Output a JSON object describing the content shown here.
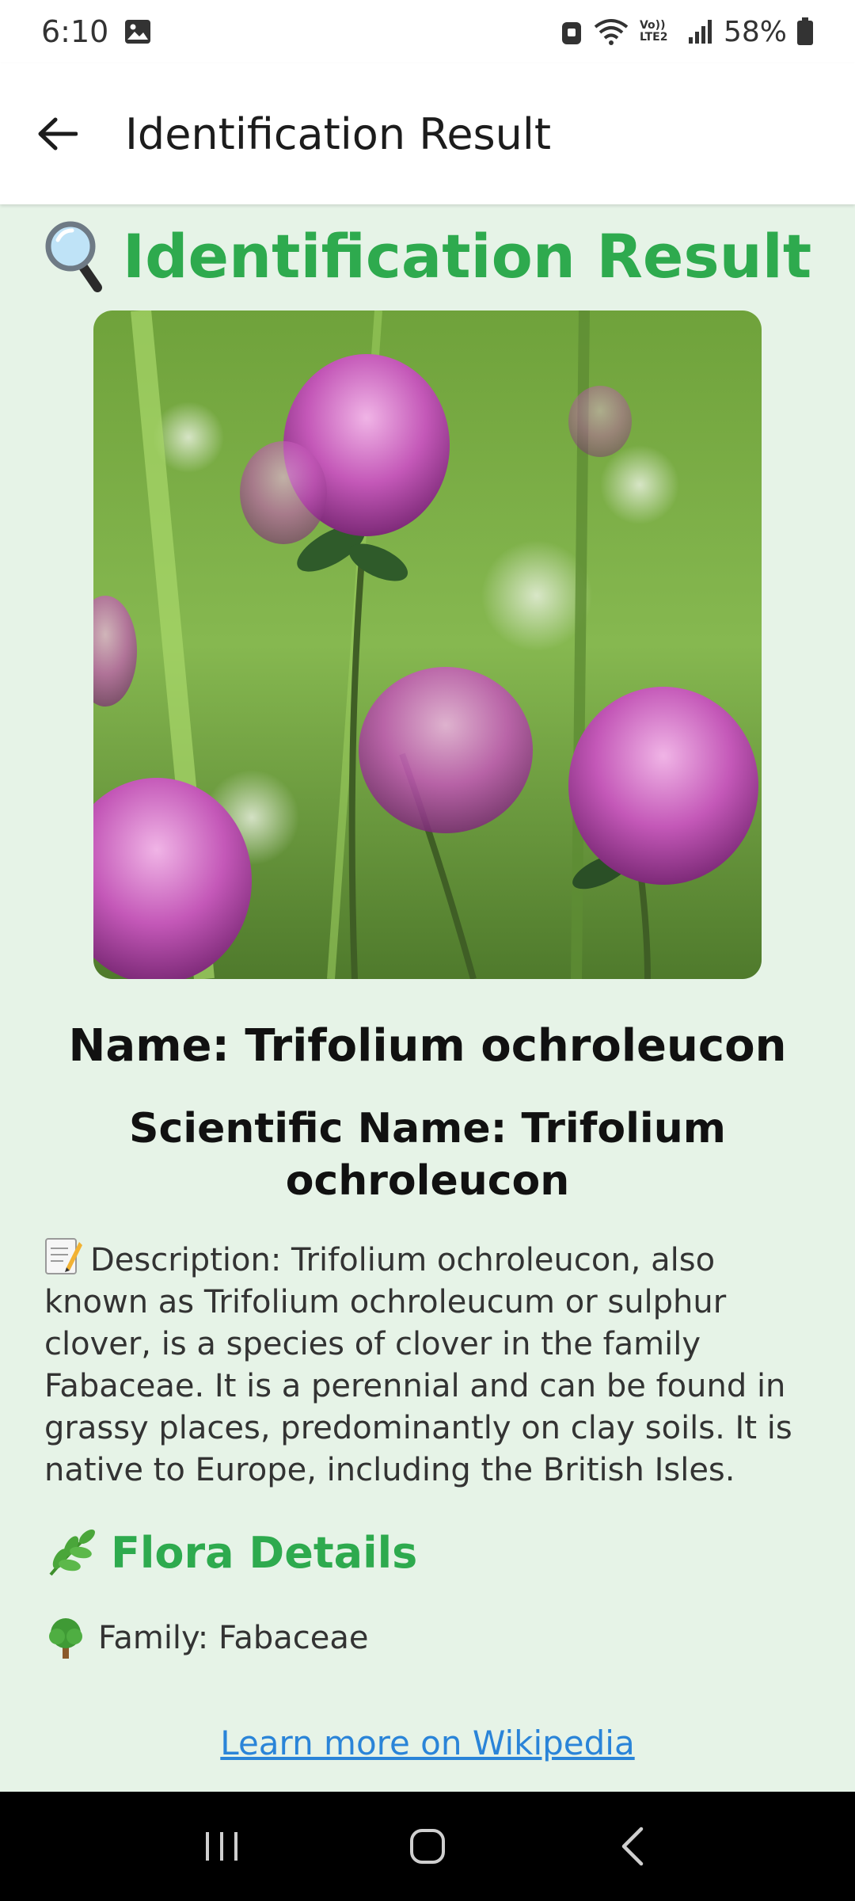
{
  "status_bar": {
    "time": "6:10",
    "battery": "58%",
    "network_label": "Vo)) LTE2"
  },
  "app_bar": {
    "title": "Identification Result"
  },
  "result": {
    "heading": "Identification Result",
    "name_line": "Name: Trifolium ochroleucon",
    "scientific_line": "Scientific Name: Trifolium ochroleucon",
    "description": "Description: Trifolium ochroleucon, also known as Trifolium ochroleucum or sulphur clover, is a species of clover in the family Fabaceae. It is a perennial and can be found in grassy places, predominantly on clay soils. It is native to Europe, including the British Isles.",
    "flora_heading": "Flora Details",
    "family_line": "Family: Fabaceae",
    "wiki_link": "Learn more on Wikipedia"
  },
  "icons": {
    "heading_icon": "magnifier-icon",
    "description_icon": "memo-icon",
    "flora_icon": "herb-icon",
    "family_icon": "tree-icon"
  },
  "colors": {
    "accent_green": "#2eaa4e",
    "background": "#e6f3e7",
    "link_blue": "#2a84d8"
  }
}
